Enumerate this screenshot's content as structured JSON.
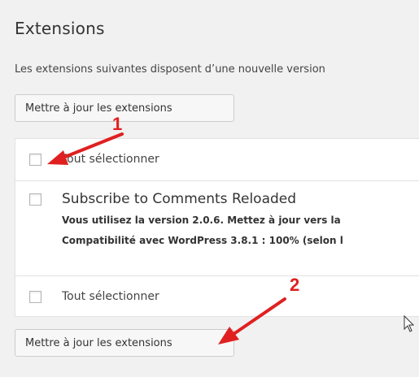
{
  "section": {
    "title": "Extensions",
    "notice": "Les extensions suivantes disposent d’une nouvelle version"
  },
  "buttons": {
    "update_top": "Mettre à jour les extensions",
    "update_bottom": "Mettre à jour les extensions"
  },
  "table": {
    "select_all_top": "Tout sélectionner",
    "select_all_bottom": "Tout sélectionner",
    "plugins": [
      {
        "name": "Subscribe to Comments Reloaded",
        "version_line": "Vous utilisez la version 2.0.6. Mettez à jour vers la",
        "compat_line": "Compatibilité avec WordPress 3.8.1 : 100% (selon l"
      }
    ]
  },
  "annotations": {
    "step_1": "1",
    "step_2": "2",
    "arrow_color": "#e02020"
  }
}
